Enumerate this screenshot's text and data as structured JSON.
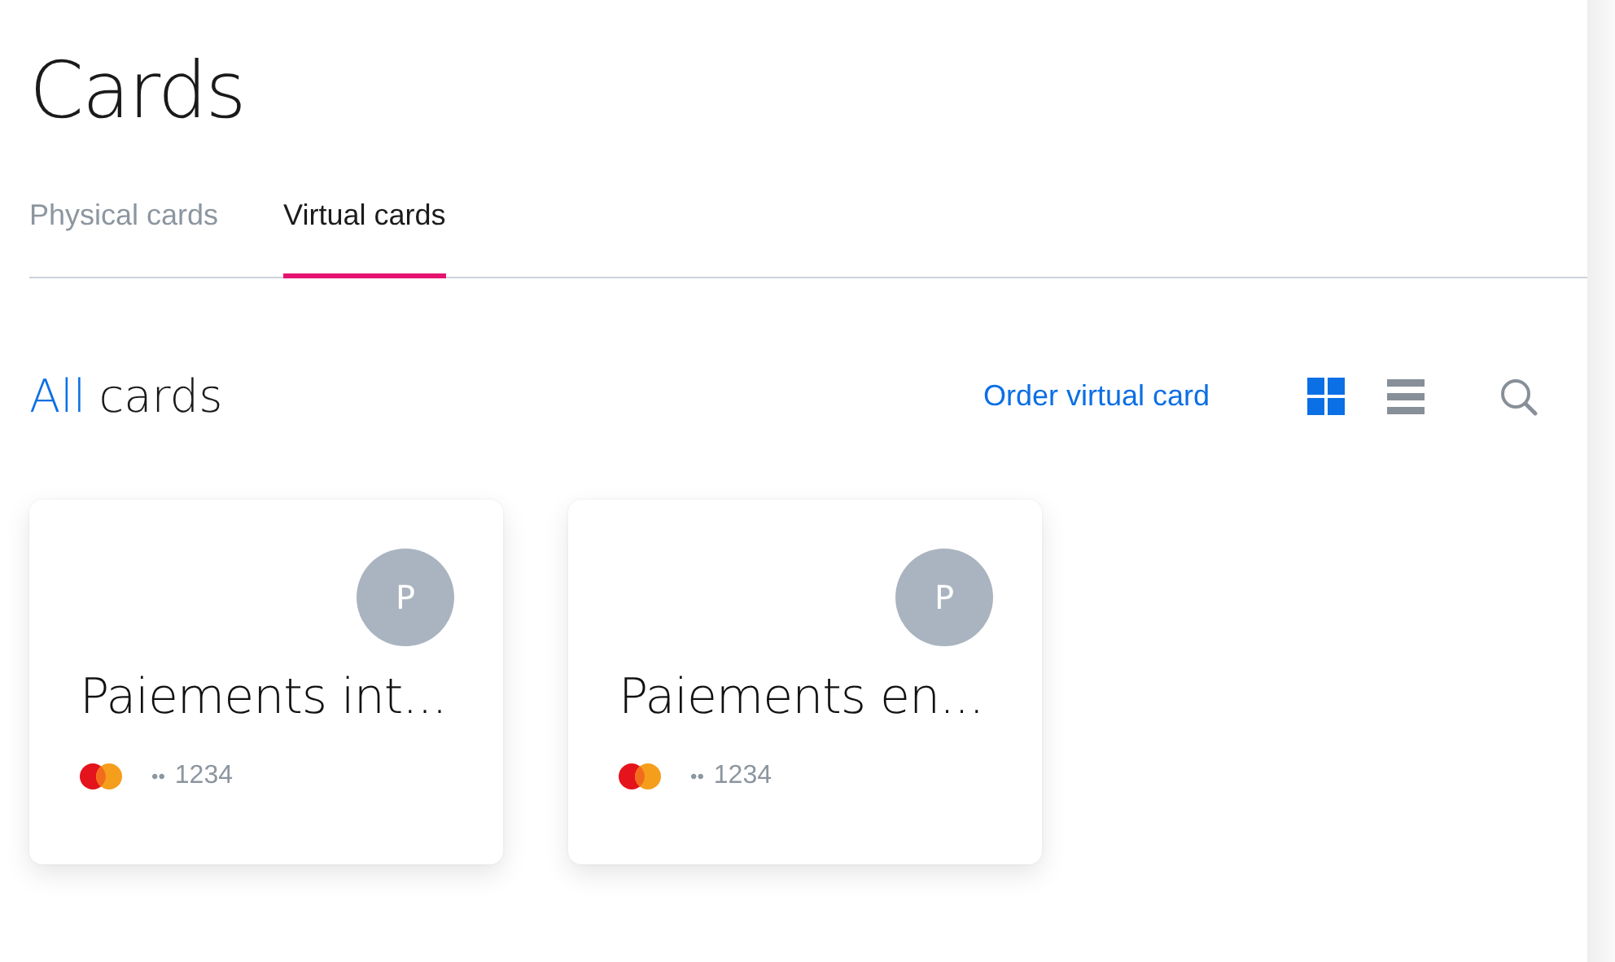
{
  "page_title": "Cards",
  "tabs": [
    {
      "label": "Physical cards",
      "selected": false
    },
    {
      "label": "Virtual cards",
      "selected": true
    }
  ],
  "section": {
    "filter": "All",
    "title": "cards",
    "action": "Order virtual card",
    "view_toggles": [
      {
        "kind": "grid",
        "selected": true
      },
      {
        "kind": "list",
        "selected": false
      }
    ]
  },
  "cards": [
    {
      "avatar": "P",
      "name": "Paiements int...",
      "dots": "••",
      "last4": "1234"
    },
    {
      "avatar": "P",
      "name": "Paiements en...",
      "dots": "••",
      "last4": "1234"
    }
  ]
}
